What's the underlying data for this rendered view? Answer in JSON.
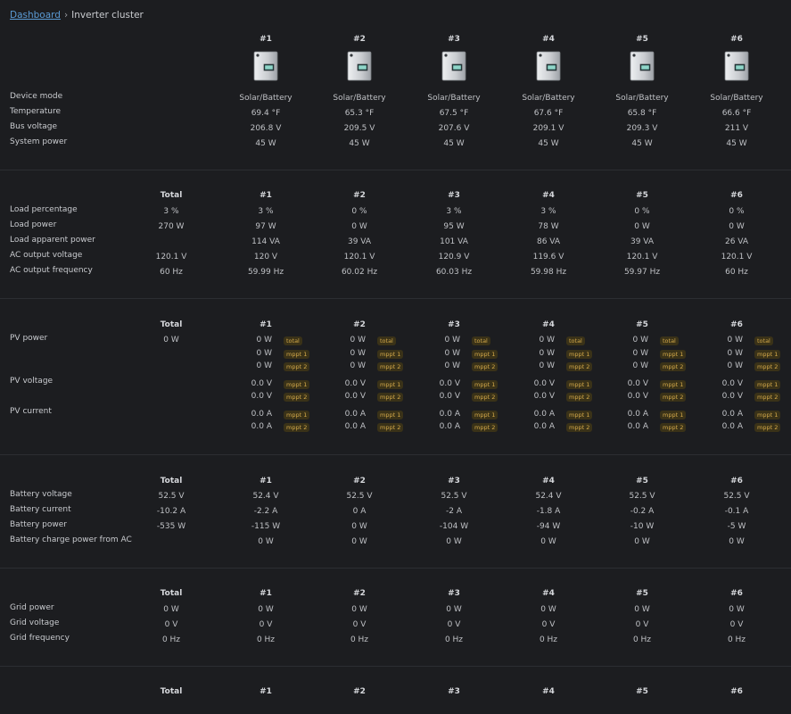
{
  "breadcrumb": {
    "root": "Dashboard",
    "sep": "›",
    "current": "Inverter cluster"
  },
  "total_label": "Total",
  "devices": [
    "#1",
    "#2",
    "#3",
    "#4",
    "#5",
    "#6"
  ],
  "sections": {
    "status": {
      "rows": [
        {
          "label": "Device mode",
          "values": [
            "Solar/Battery",
            "Solar/Battery",
            "Solar/Battery",
            "Solar/Battery",
            "Solar/Battery",
            "Solar/Battery"
          ]
        },
        {
          "label": "Temperature",
          "values": [
            "69.4 °F",
            "65.3 °F",
            "67.5 °F",
            "67.6 °F",
            "65.8 °F",
            "66.6 °F"
          ]
        },
        {
          "label": "Bus voltage",
          "values": [
            "206.8 V",
            "209.5 V",
            "207.6 V",
            "209.1 V",
            "209.3 V",
            "211 V"
          ]
        },
        {
          "label": "System power",
          "values": [
            "45 W",
            "45 W",
            "45 W",
            "45 W",
            "45 W",
            "45 W"
          ]
        }
      ]
    },
    "load": {
      "rows": [
        {
          "label": "Load percentage",
          "total": "3 %",
          "values": [
            "3 %",
            "0 %",
            "3 %",
            "3 %",
            "0 %",
            "0 %"
          ]
        },
        {
          "label": "Load power",
          "total": "270 W",
          "values": [
            "97 W",
            "0 W",
            "95 W",
            "78 W",
            "0 W",
            "0 W"
          ]
        },
        {
          "label": "Load apparent power",
          "total": "",
          "values": [
            "114 VA",
            "39 VA",
            "101 VA",
            "86 VA",
            "39 VA",
            "26 VA"
          ]
        },
        {
          "label": "AC output voltage",
          "total": "120.1 V",
          "values": [
            "120 V",
            "120.1 V",
            "120.9 V",
            "119.6 V",
            "120.1 V",
            "120.1 V"
          ]
        },
        {
          "label": "AC output frequency",
          "total": "60 Hz",
          "values": [
            "59.99 Hz",
            "60.02 Hz",
            "60.03 Hz",
            "59.98 Hz",
            "59.97 Hz",
            "60 Hz"
          ]
        }
      ]
    },
    "pv": {
      "power_label": "PV power",
      "voltage_label": "PV voltage",
      "current_label": "PV current",
      "power_total": "0 W",
      "tags": {
        "total": "total",
        "mppt1": "mppt 1",
        "mppt2": "mppt 2"
      },
      "power_values": [
        "0 W",
        "0 W",
        "0 W"
      ],
      "voltage_values": [
        "0.0 V",
        "0.0 V"
      ],
      "current_values": [
        "0.0 A",
        "0.0 A"
      ]
    },
    "battery": {
      "rows": [
        {
          "label": "Battery voltage",
          "total": "52.5 V",
          "values": [
            "52.4 V",
            "52.5 V",
            "52.5 V",
            "52.4 V",
            "52.5 V",
            "52.5 V"
          ]
        },
        {
          "label": "Battery current",
          "total": "-10.2 A",
          "values": [
            "-2.2 A",
            "0 A",
            "-2 A",
            "-1.8 A",
            "-0.2 A",
            "-0.1 A"
          ]
        },
        {
          "label": "Battery power",
          "total": "-535 W",
          "values": [
            "-115 W",
            "0 W",
            "-104 W",
            "-94 W",
            "-10 W",
            "-5 W"
          ]
        },
        {
          "label": "Battery charge power from AC",
          "total": "",
          "values": [
            "0 W",
            "0 W",
            "0 W",
            "0 W",
            "0 W",
            "0 W"
          ]
        }
      ]
    },
    "grid": {
      "rows": [
        {
          "label": "Grid power",
          "total": "0 W",
          "values": [
            "0 W",
            "0 W",
            "0 W",
            "0 W",
            "0 W",
            "0 W"
          ]
        },
        {
          "label": "Grid voltage",
          "total": "0 V",
          "values": [
            "0 V",
            "0 V",
            "0 V",
            "0 V",
            "0 V",
            "0 V"
          ]
        },
        {
          "label": "Grid frequency",
          "total": "0 Hz",
          "values": [
            "0 Hz",
            "0 Hz",
            "0 Hz",
            "0 Hz",
            "0 Hz",
            "0 Hz"
          ]
        }
      ]
    }
  }
}
